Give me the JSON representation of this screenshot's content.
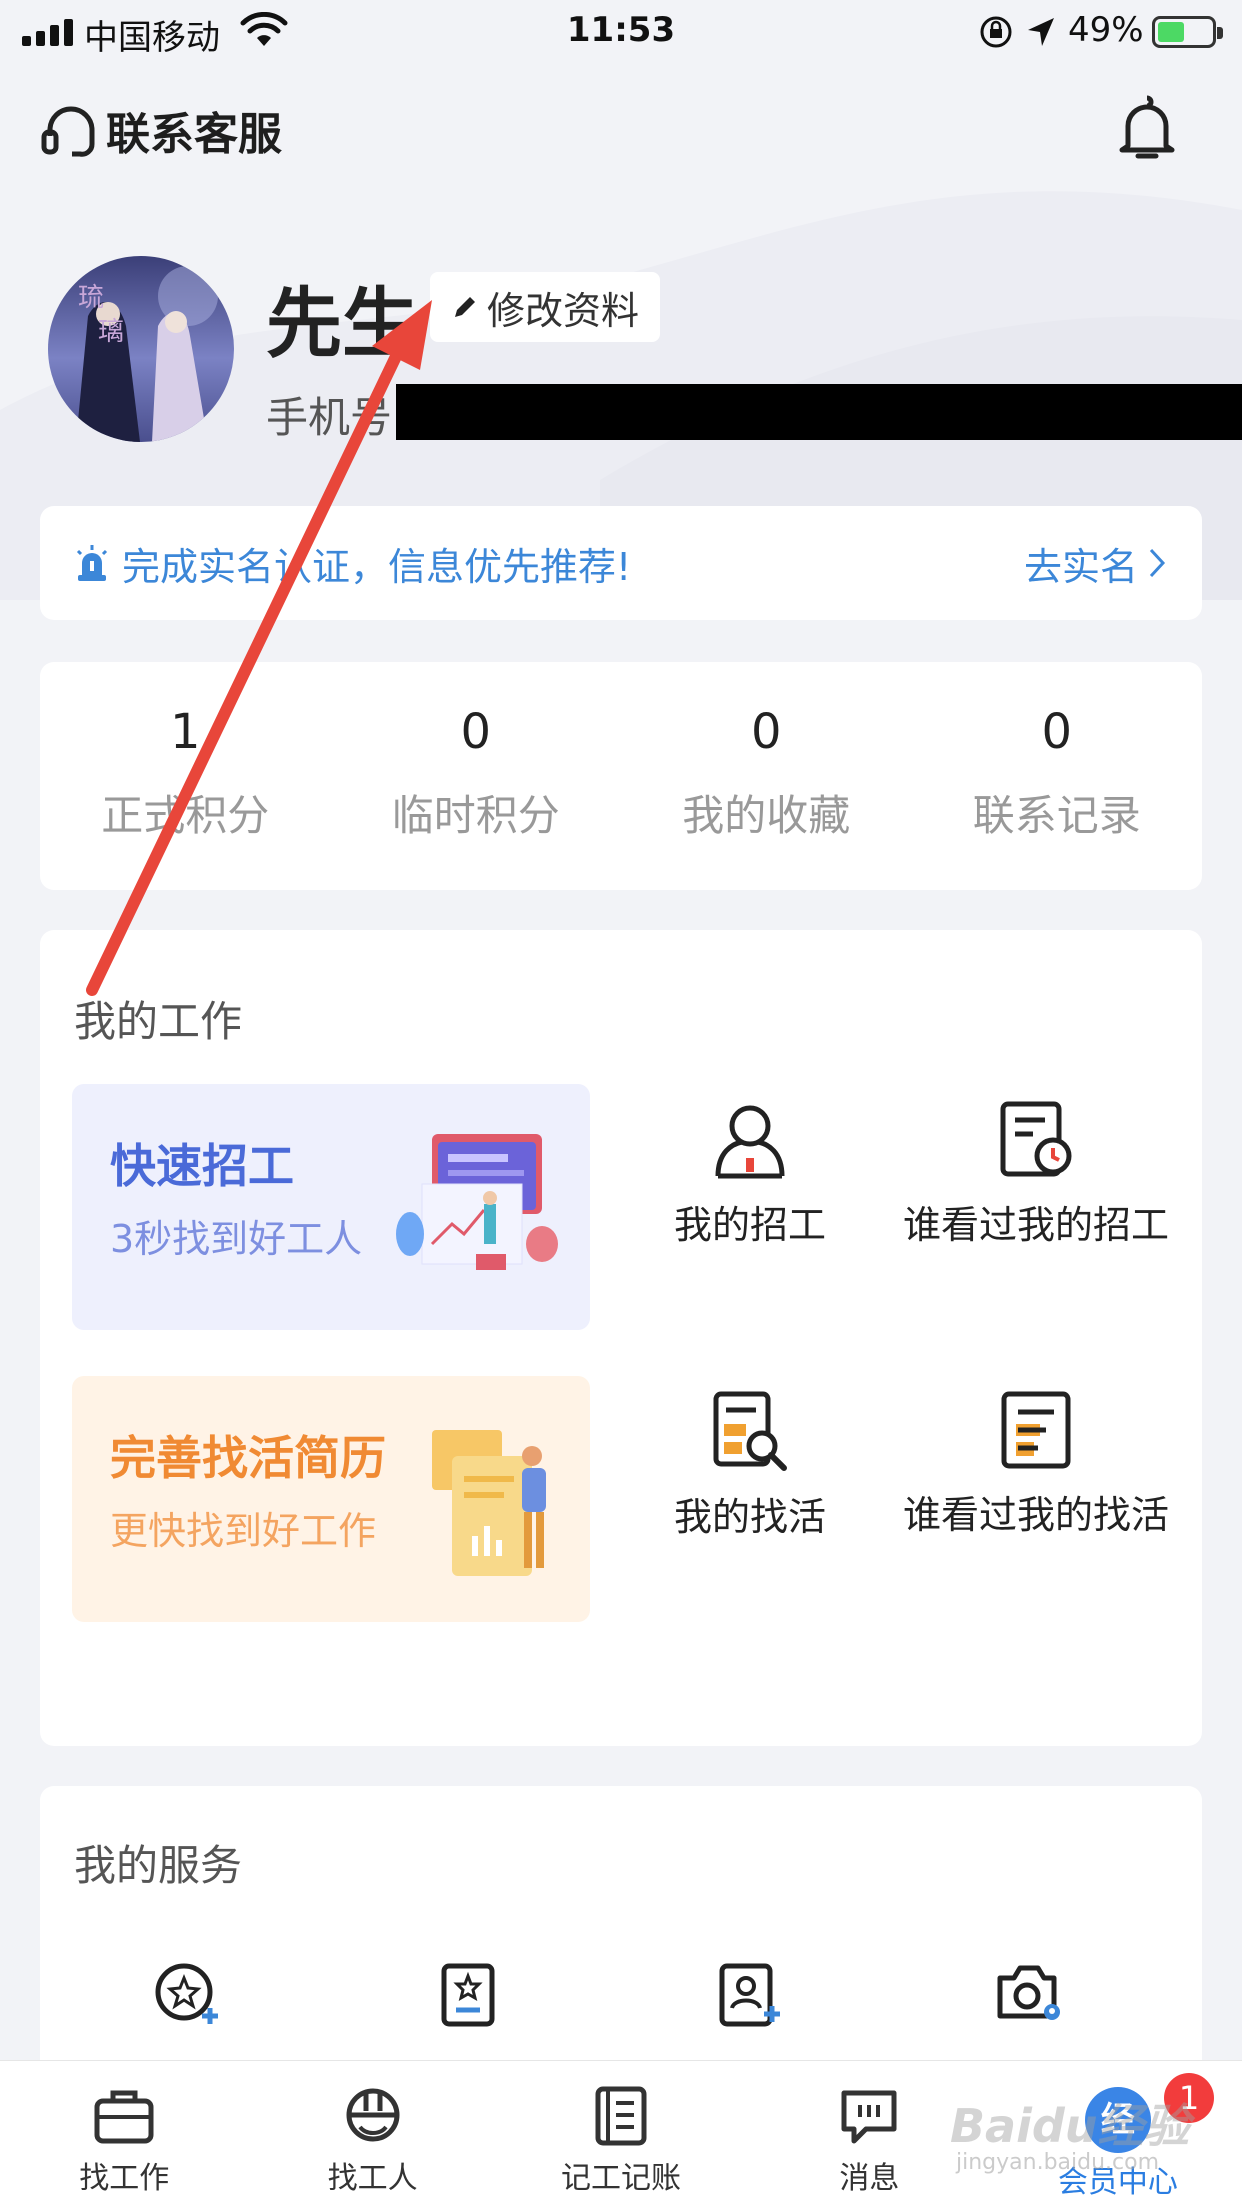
{
  "status_bar": {
    "carrier": "中国移动",
    "time": "11:53",
    "battery_percent": "49%"
  },
  "header": {
    "customer_service_label": "联系客服"
  },
  "profile": {
    "name": "先生",
    "edit_label": "修改资料",
    "phone_label": "手机号"
  },
  "notice": {
    "text": "完成实名认证，信息优先推荐!",
    "link_label": "去实名"
  },
  "stats": [
    {
      "value": "1",
      "label": "正式积分"
    },
    {
      "value": "0",
      "label": "临时积分"
    },
    {
      "value": "0",
      "label": "我的收藏"
    },
    {
      "value": "0",
      "label": "联系记录"
    }
  ],
  "my_work": {
    "title": "我的工作",
    "promo_recruit": {
      "title": "快速招工",
      "subtitle": "3秒找到好工人"
    },
    "promo_resume": {
      "title": "完善找活简历",
      "subtitle": "更快找到好工作"
    },
    "items": [
      {
        "label": "我的招工"
      },
      {
        "label": "谁看过我的招工"
      },
      {
        "label": "我的找活"
      },
      {
        "label": "谁看过我的找活"
      }
    ]
  },
  "my_services": {
    "title": "我的服务"
  },
  "tabbar": {
    "tabs": [
      {
        "label": "找工作"
      },
      {
        "label": "找工人"
      },
      {
        "label": "记工记账"
      },
      {
        "label": "消息"
      },
      {
        "label": "会员中心"
      }
    ],
    "badge": "1",
    "member_icon_text": "经验"
  },
  "watermark": {
    "text": "Baidu经验",
    "sub": "jingyan.baidu.com"
  },
  "colors": {
    "accent_blue": "#3c87d8",
    "active_tab": "#2a7de1",
    "badge_red": "#f23c3c",
    "annotation_arrow": "#e8463a"
  }
}
